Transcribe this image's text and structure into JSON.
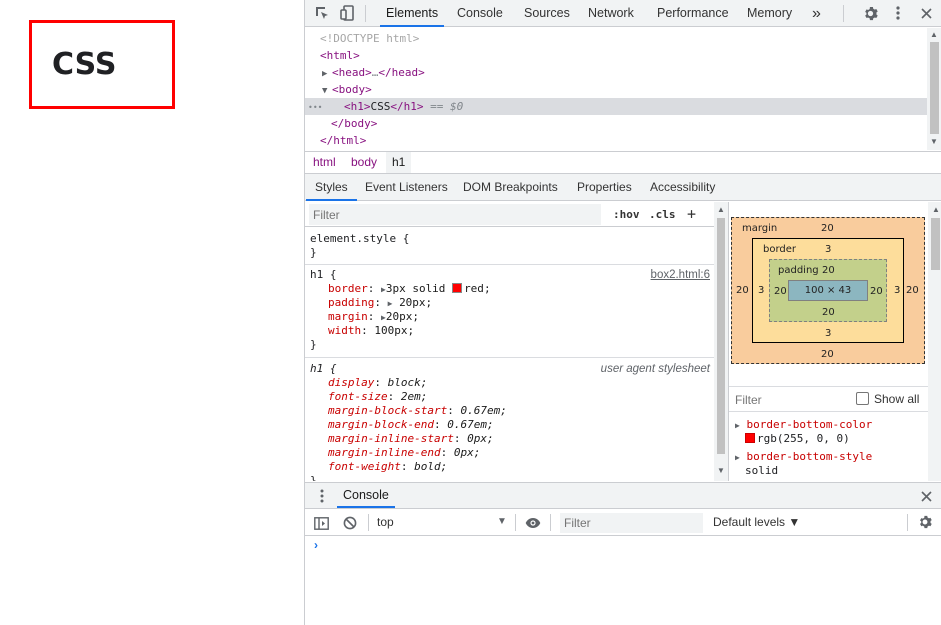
{
  "page": {
    "heading": "CSS"
  },
  "devtools": {
    "tabs": [
      "Elements",
      "Console",
      "Sources",
      "Network",
      "Performance",
      "Memory"
    ],
    "more_tabs": "»",
    "active_tab": "Elements",
    "tree": {
      "doctype": "<!DOCTYPE html>",
      "html_open": "<html>",
      "head_open": "<head>",
      "head_ellipsis": "…",
      "head_close": "</head>",
      "body_open": "<body>",
      "h1_open": "<h1>",
      "h1_text": "CSS",
      "h1_close": "</h1>",
      "selected_marker": "== $0",
      "dots": "•••",
      "body_close": "</body>",
      "html_close": "</html>"
    },
    "breadcrumbs": [
      "html",
      "body",
      "h1"
    ],
    "subtabs": [
      "Styles",
      "Event Listeners",
      "DOM Breakpoints",
      "Properties",
      "Accessibility"
    ],
    "styles": {
      "filter_placeholder": "Filter",
      "hov": ":hov",
      "cls": ".cls",
      "add": "+",
      "element_style": {
        "selector": "element.style {",
        "close": "}"
      },
      "h1_rule": {
        "selector": "h1",
        "brace": "{",
        "source": "box2.html:6",
        "props": [
          {
            "name": "border",
            "value": "3px solid",
            "color_value": "red",
            "color": "#ff0000"
          },
          {
            "name": "padding",
            "value": "20px;"
          },
          {
            "name": "margin",
            "value": "20px;"
          },
          {
            "name": "width",
            "value": "100px;"
          }
        ],
        "close": "}"
      },
      "ua_rule": {
        "selector": "h1",
        "brace": "{",
        "source": "user agent stylesheet",
        "props": [
          {
            "name": "display",
            "value": "block;"
          },
          {
            "name": "font-size",
            "value": "2em;"
          },
          {
            "name": "margin-block-start",
            "value": "0.67em;"
          },
          {
            "name": "margin-block-end",
            "value": "0.67em;"
          },
          {
            "name": "margin-inline-start",
            "value": "0px;"
          },
          {
            "name": "margin-inline-end",
            "value": "0px;"
          },
          {
            "name": "font-weight",
            "value": "bold;"
          }
        ],
        "close": "}"
      }
    },
    "box_model": {
      "margin_label": "margin",
      "margin_top": "20",
      "margin_bottom": "20",
      "margin_left": "20",
      "margin_right": "20",
      "border_label": "border",
      "border_top": "3",
      "border_bottom": "3",
      "border_left": "3",
      "border_right": "3",
      "padding_label": "padding",
      "padding_top": "20",
      "padding_bottom": "20",
      "padding_left": "20",
      "padding_right": "20",
      "content": "100 × 43"
    },
    "computed": {
      "filter_placeholder": "Filter",
      "show_all": "Show all",
      "props": [
        {
          "name": "border-bottom-color",
          "value": "rgb(255, 0, 0)"
        },
        {
          "name": "border-bottom-style",
          "value": "solid"
        }
      ]
    },
    "console_drawer": {
      "title": "Console",
      "context": "top",
      "filter_placeholder": "Filter",
      "levels": "Default levels ▼",
      "prompt": "›"
    },
    "colors": {
      "accent": "#1a73e8",
      "tag": "#881280",
      "property": "#c80000",
      "margin": "#f9cc9d",
      "border": "#fddd9b",
      "padding": "#c3d08b",
      "content": "#8cb6c0"
    }
  }
}
